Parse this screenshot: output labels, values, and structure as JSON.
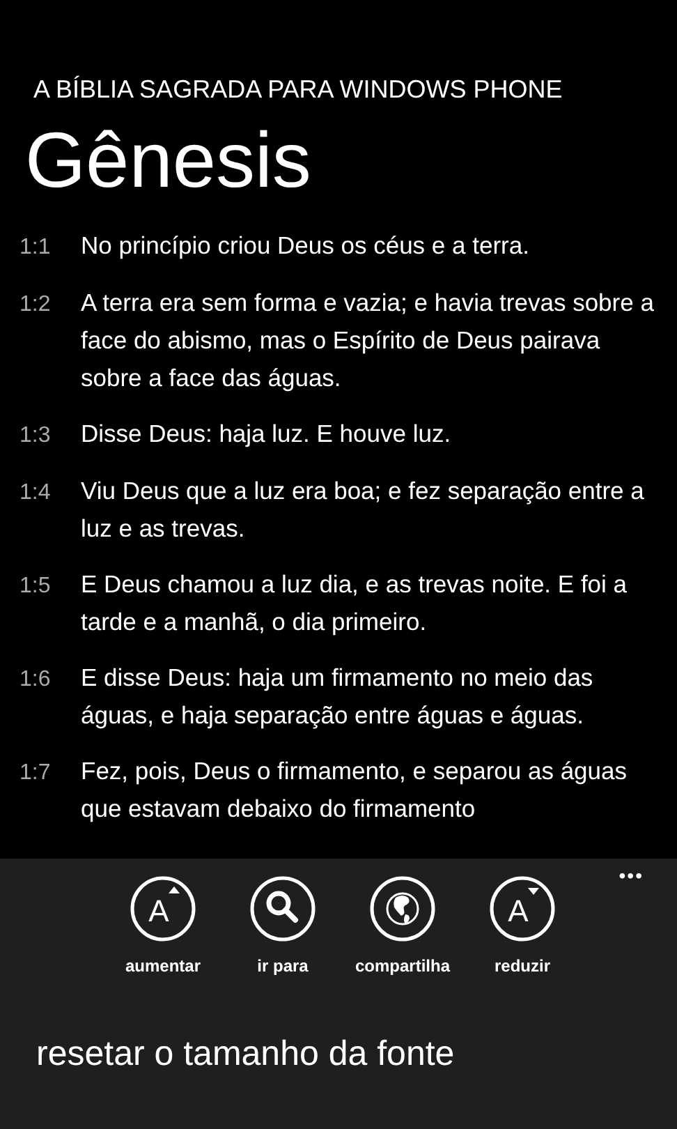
{
  "app_title": "A BÍBLIA SAGRADA PARA WINDOWS PHONE",
  "book_title": "Gênesis",
  "verses": [
    {
      "number": "1:1",
      "text": "No princípio criou Deus os céus e a terra."
    },
    {
      "number": "1:2",
      "text": "A terra era sem forma e vazia; e havia trevas sobre a face do abismo, mas o Espírito de Deus pairava sobre a face das águas."
    },
    {
      "number": "1:3",
      "text": "Disse Deus: haja luz. E houve luz."
    },
    {
      "number": "1:4",
      "text": "Viu Deus que a luz era boa; e fez separação entre a luz e as trevas."
    },
    {
      "number": "1:5",
      "text": "E Deus chamou a luz dia, e as trevas noite. E foi a tarde e a manhã, o dia primeiro."
    },
    {
      "number": "1:6",
      "text": "E disse Deus: haja um firmamento no meio das águas, e haja separação entre águas e águas."
    },
    {
      "number": "1:7",
      "text": "Fez, pois, Deus o firmamento, e separou as águas que estavam debaixo do firmamento"
    }
  ],
  "app_bar": {
    "more": "•••",
    "buttons": [
      {
        "kind": "font-up",
        "glyph": "A",
        "label": "aumentar"
      },
      {
        "kind": "search",
        "label": "ir para"
      },
      {
        "kind": "globe",
        "label": "compartilha"
      },
      {
        "kind": "font-down",
        "glyph": "A",
        "label": "reduzir"
      }
    ],
    "menu_items": [
      "resetar o tamanho da fonte"
    ]
  }
}
